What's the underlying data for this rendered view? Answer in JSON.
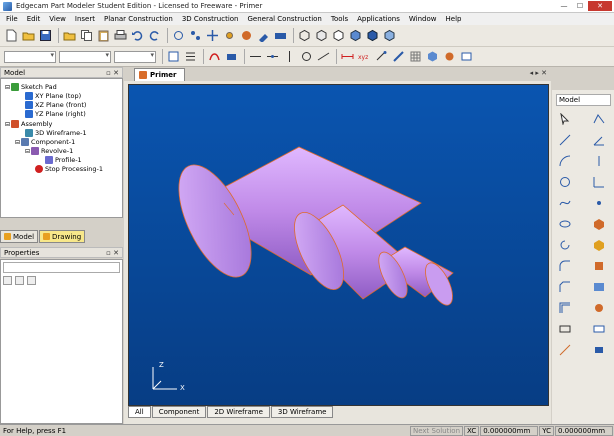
{
  "window": {
    "title": "Edgecam Part Modeler Student Edition - Licensed to Freeware - Primer"
  },
  "menu": [
    "File",
    "Edit",
    "View",
    "Insert",
    "Planar Construction",
    "3D Construction",
    "General Construction",
    "Tools",
    "Applications",
    "Window",
    "Help"
  ],
  "model_pane": {
    "title": "Model",
    "tree": [
      {
        "label": "Sketch Pad",
        "icon": "sketch-pad-icon",
        "color": "#3a9c3a"
      },
      {
        "label": "XY Plane (top)",
        "icon": "plane-icon",
        "color": "#2a6ad0"
      },
      {
        "label": "XZ Plane (front)",
        "icon": "plane-icon",
        "color": "#2a6ad0"
      },
      {
        "label": "YZ Plane (right)",
        "icon": "plane-icon",
        "color": "#2a6ad0"
      },
      {
        "label": "Assembly",
        "icon": "assembly-icon",
        "color": "#d0502a"
      },
      {
        "label": "3D Wireframe-1",
        "icon": "wireframe-icon",
        "color": "#3a8aaa"
      },
      {
        "label": "Component-1",
        "icon": "component-icon",
        "color": "#5a7ab0"
      },
      {
        "label": "Revolve-1",
        "icon": "revolve-icon",
        "color": "#8a5ab0"
      },
      {
        "label": "Profile-1",
        "icon": "profile-icon",
        "color": "#6a6ad0"
      },
      {
        "label": "Stop Processing-1",
        "icon": "stop-icon",
        "color": "#d02020"
      }
    ],
    "tabs": [
      {
        "label": "Model"
      },
      {
        "label": "Drawing"
      }
    ]
  },
  "properties_pane": {
    "title": "Properties"
  },
  "document": {
    "tab": "Primer",
    "view_tabs": [
      "All",
      "Component",
      "2D Wireframe",
      "3D Wireframe"
    ],
    "axis_labels": {
      "z": "Z",
      "x": "X"
    }
  },
  "right_pane": {
    "combo": "Model"
  },
  "status": {
    "help": "For Help, press F1",
    "next_solution": "Next Solution",
    "xc_label": "XC",
    "xc_value": "0.000000mm",
    "yc_label": "YC",
    "yc_value": "0.000000mm"
  },
  "colors": {
    "viewport_top": "#0a55b0",
    "part": "#c08ae8",
    "part_edge": "#e06a2a"
  }
}
